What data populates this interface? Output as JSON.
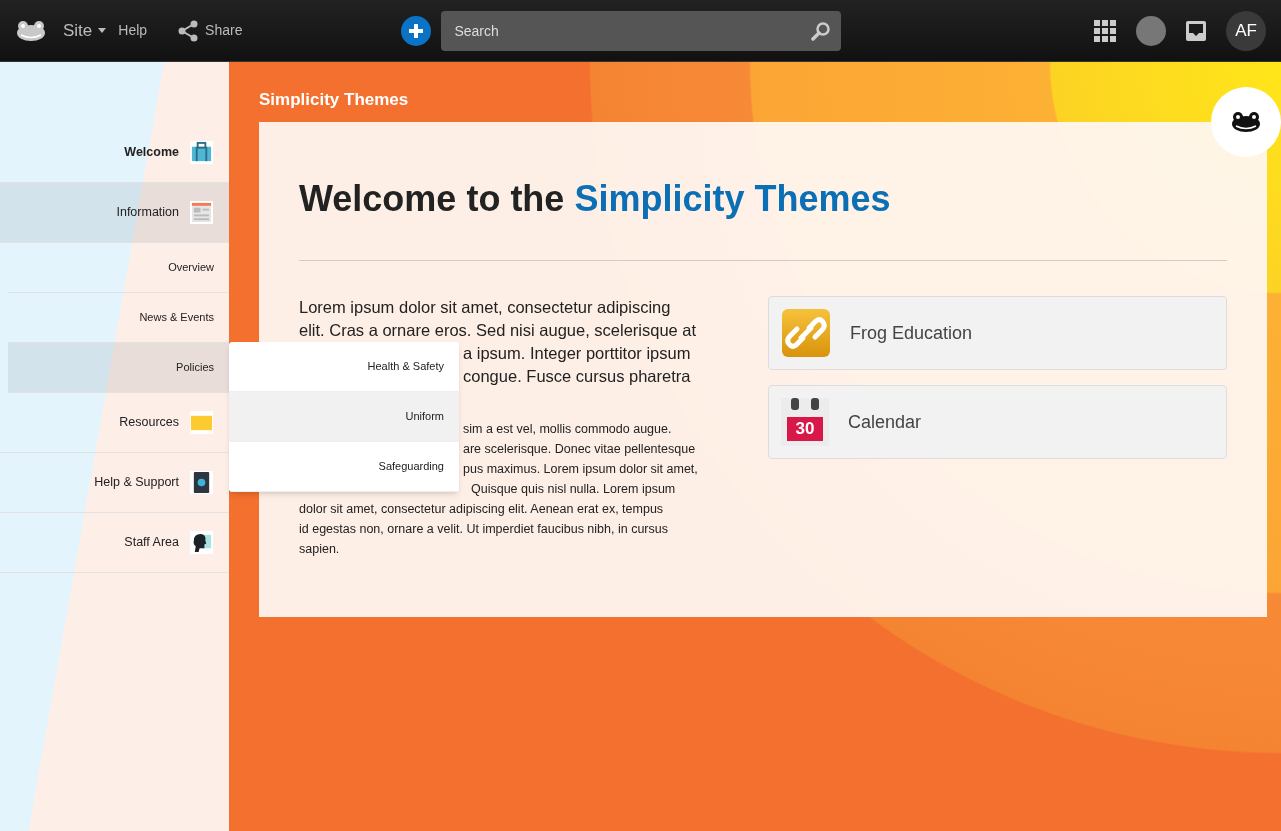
{
  "topbar": {
    "site_label": "Site",
    "help": "Help",
    "share": "Share",
    "search": {
      "placeholder": "Search"
    },
    "avatar": "AF"
  },
  "sidebar": {
    "items": [
      {
        "label": "Welcome",
        "kind": "main",
        "current": true,
        "selected": false
      },
      {
        "label": "Information",
        "kind": "main",
        "current": false,
        "selected": true
      },
      {
        "label": "Overview",
        "kind": "sub",
        "current": false,
        "selected": false
      },
      {
        "label": "News & Events",
        "kind": "sub",
        "current": false,
        "selected": false
      },
      {
        "label": "Policies",
        "kind": "sub",
        "current": false,
        "selected": true
      },
      {
        "label": "Resources",
        "kind": "main",
        "current": false,
        "selected": false
      },
      {
        "label": "Help & Support",
        "kind": "main",
        "current": false,
        "selected": false
      },
      {
        "label": "Staff Area",
        "kind": "main",
        "current": false,
        "selected": false
      }
    ]
  },
  "dropdown": {
    "items": [
      {
        "label": "Health & Safety",
        "selected": false
      },
      {
        "label": "Uniform",
        "selected": true
      },
      {
        "label": "Safeguarding",
        "selected": false
      }
    ]
  },
  "page": {
    "section_title": "Simplicity Themes",
    "title": "Welcome to the",
    "title_highlight": "Simplicity Themes",
    "lead_lines": [
      {
        "text": "Lorem ipsum dolor sit amet, consectetur adipiscing",
        "kind": "full"
      },
      {
        "text": "elit. Cras a ornare eros. Sed nisi augue, scelerisque at",
        "kind": "full"
      },
      {
        "text": "a ipsum. Integer porttitor ipsum",
        "kind": "covered"
      },
      {
        "text": "congue. Fusce cursus pharetra",
        "kind": "covered"
      }
    ],
    "body_lines": [
      {
        "text": "sim a est vel, mollis commodo augue.",
        "kind": "covered"
      },
      {
        "text": "are scelerisque. Donec vitae pellentesque",
        "kind": "covered"
      },
      {
        "text": "pus maximus. Lorem ipsum dolor sit amet,",
        "kind": "covered"
      },
      {
        "text": "Quisque quis nisl nulla. Lorem ipsum",
        "kind": "clipped"
      },
      {
        "text": "dolor sit amet, consectetur adipiscing elit. Aenean erat ex, tempus",
        "kind": "full"
      },
      {
        "text": "id egestas non, ornare a velit. Ut imperdiet faucibus nibh, in cursus",
        "kind": "full"
      },
      {
        "text": "sapien.",
        "kind": "full"
      }
    ],
    "links": [
      {
        "label": "Frog Education"
      },
      {
        "label": "Calendar",
        "day": "30"
      }
    ]
  }
}
